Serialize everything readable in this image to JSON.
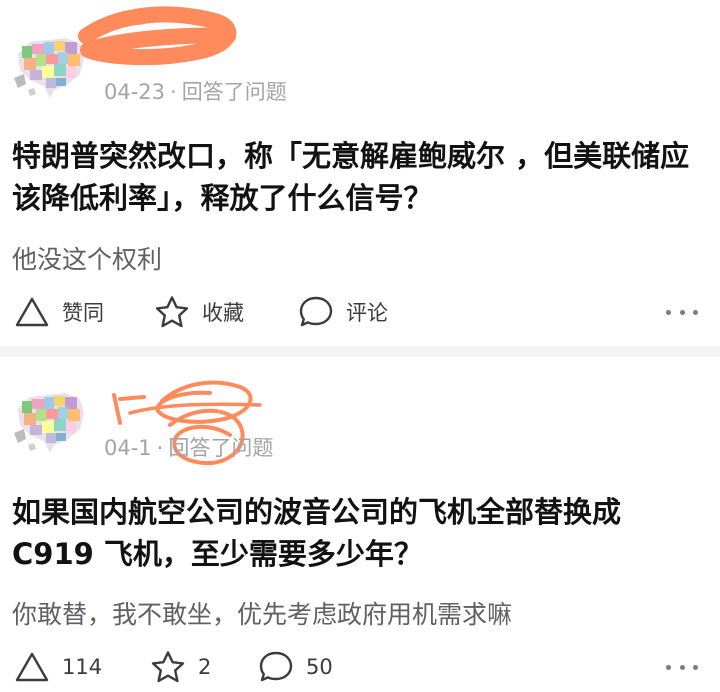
{
  "posts": [
    {
      "meta_date": "04-23",
      "meta_sep": "·",
      "meta_action": "回答了问题",
      "title": "特朗普突然改口，称「无意解雇鲍威尔 ，但美联储应该降低利率」，释放了什么信号？",
      "excerpt": "他没这个权利",
      "actions": {
        "like": "赞同",
        "favorite": "收藏",
        "comment": "评论"
      }
    },
    {
      "meta_date": "04-1",
      "meta_sep": "·",
      "meta_action": "回答了问题",
      "title": "如果国内航空公司的波音公司的飞机全部替换成C919 飞机，至少需要多少年？",
      "excerpt": "你敢替，我不敢坐，优先考虑政府用机需求嘛",
      "actions": {
        "like": "114",
        "favorite": "2",
        "comment": "50"
      }
    }
  ],
  "colors": {
    "scribble": "#ff8a5c",
    "meta": "#a3a3a9",
    "divider": "#f3f3f5"
  },
  "icons": [
    "triangle-upvote-icon",
    "star-icon",
    "speech-bubble-icon",
    "more-dots-icon"
  ]
}
